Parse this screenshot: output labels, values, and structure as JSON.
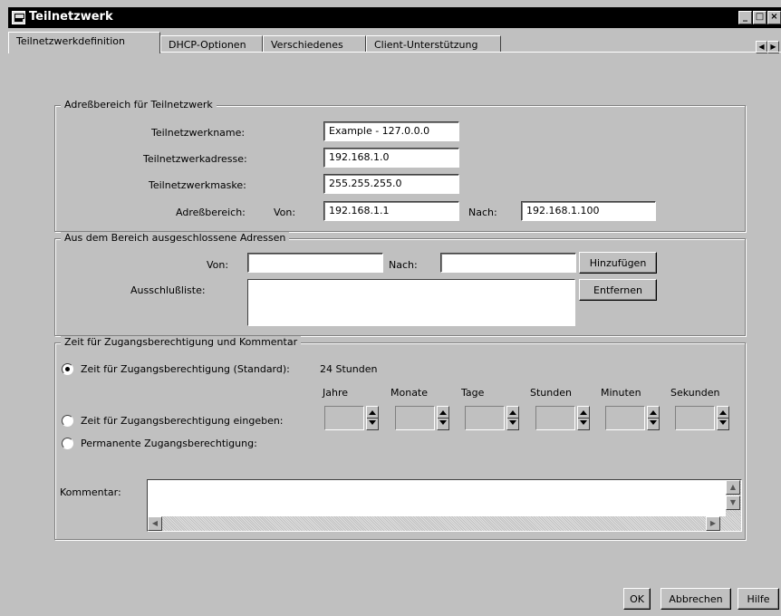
{
  "window": {
    "title": "Teilnetzwerk",
    "controls": [
      "_",
      "□",
      "×"
    ]
  },
  "tabs": [
    {
      "label": "Teilnetzwerkdefinition"
    },
    {
      "label": "DHCP-Optionen"
    },
    {
      "label": "Verschiedenes"
    },
    {
      "label": "Client-Unterstützung"
    }
  ],
  "tab_scroll": {
    "left": "◀",
    "right": "▶"
  },
  "address_group": {
    "title": "Adreßbereich für Teilnetzwerk",
    "name_label": "Teilnetzwerkname:",
    "name_value": "Example - 127.0.0.0",
    "address_label": "Teilnetzwerkadresse:",
    "address_value": "192.168.1.0",
    "mask_label": "Teilnetzwerkmaske:",
    "mask_value": "255.255.255.0",
    "range_label": "Adreßbereich:",
    "from_label": "Von:",
    "from_value": "192.168.1.1",
    "to_label": "Nach:",
    "to_value": "192.168.1.100"
  },
  "excluded_group": {
    "title": "Aus dem Bereich ausgeschlossene Adressen",
    "from_label": "Von:",
    "from_value": "",
    "to_label": "Nach:",
    "to_value": "",
    "add_button": "Hinzufügen",
    "list_label": "Ausschlußliste:",
    "remove_button": "Entfernen"
  },
  "lease_group": {
    "title": "Zeit für Zugangsberechtigung und Kommentar",
    "option_standard": "Zeit für Zugangsberechtigung (Standard):",
    "standard_value": "24 Stunden",
    "option_custom": "Zeit für Zugangsberechtigung eingeben:",
    "option_permanent": "Permanente Zugangsberechtigung:",
    "selected": "standard",
    "units": [
      "Jahre",
      "Monate",
      "Tage",
      "Stunden",
      "Minuten",
      "Sekunden"
    ],
    "comment_label": "Kommentar:",
    "comment_value": ""
  },
  "footer": {
    "ok": "OK",
    "cancel": "Abbrechen",
    "help": "Hilfe"
  }
}
